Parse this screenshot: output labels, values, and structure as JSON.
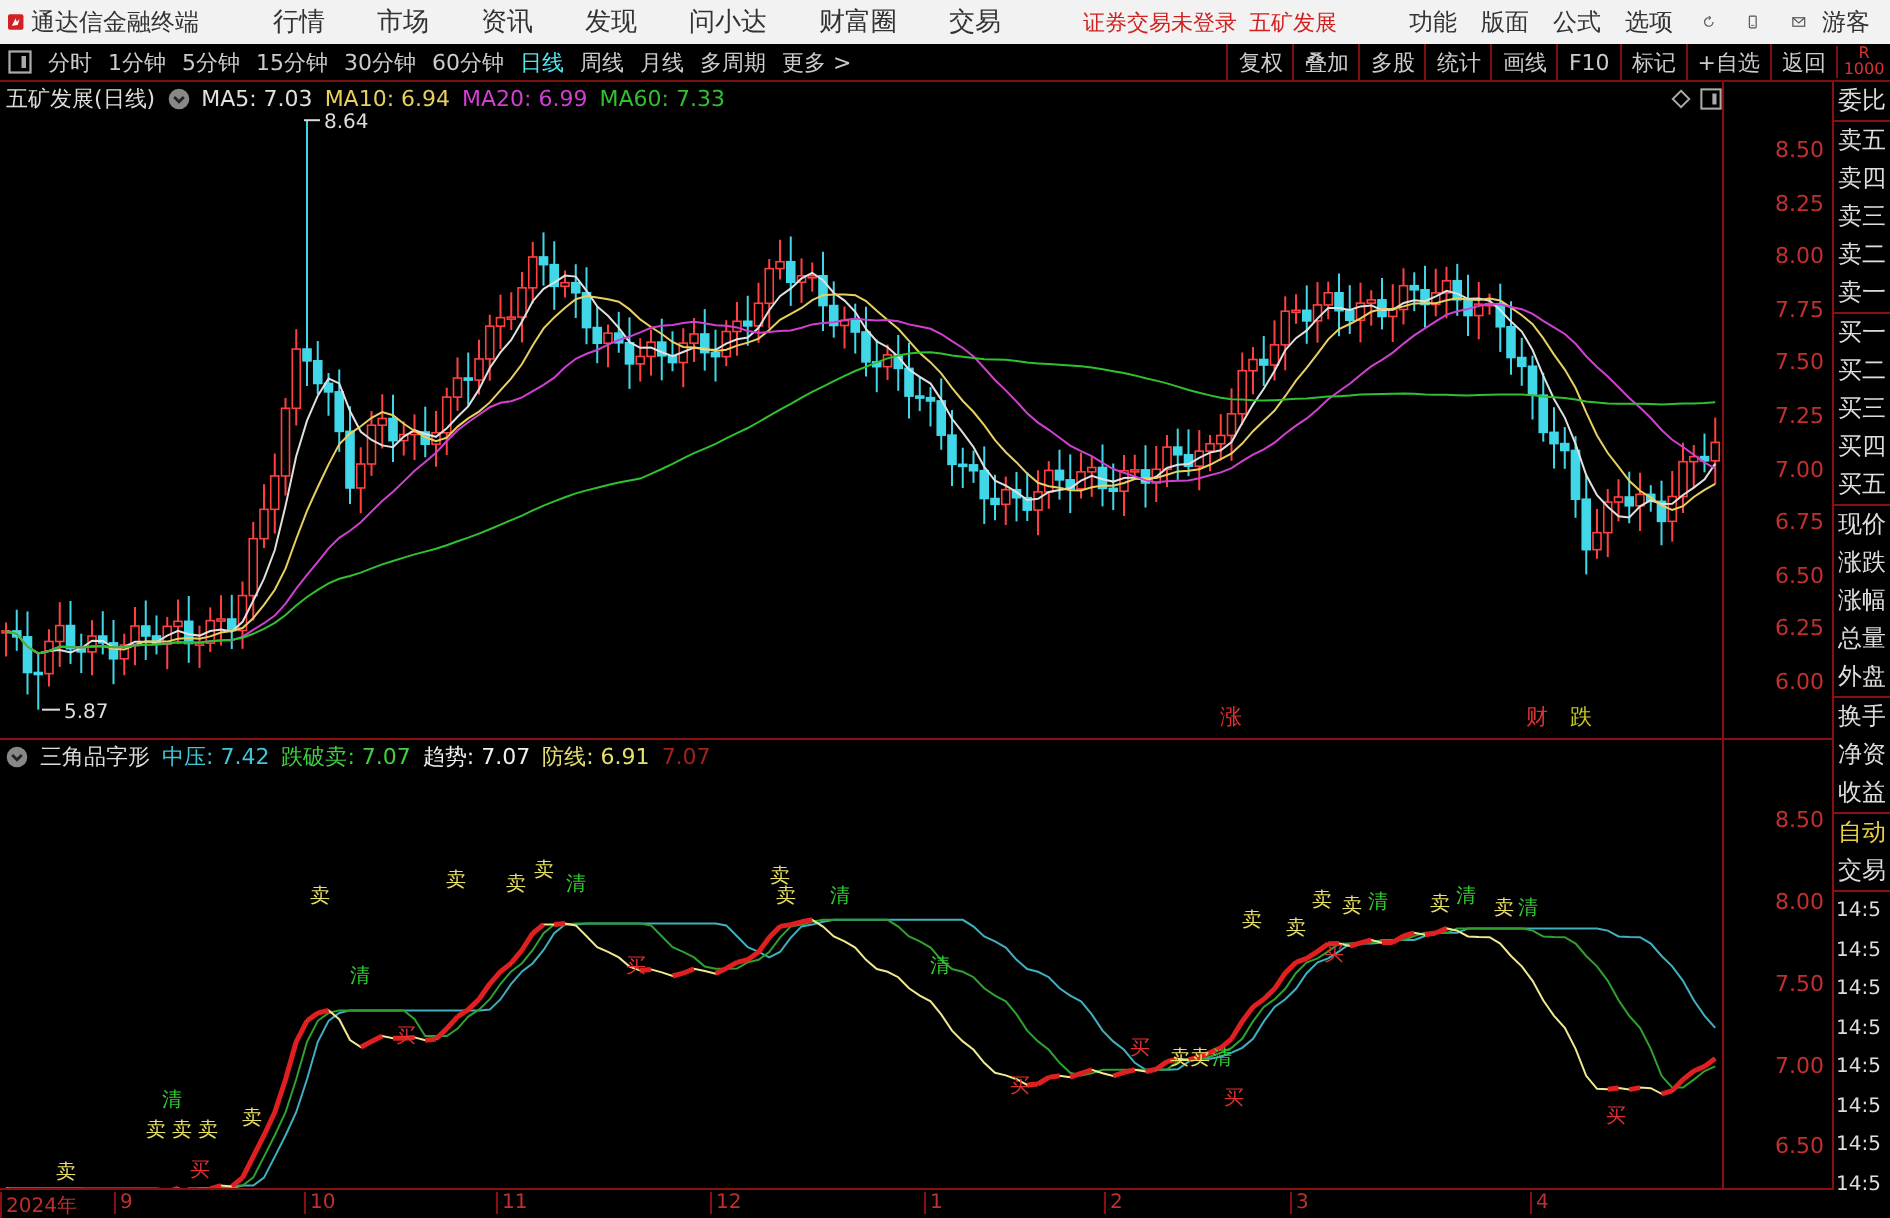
{
  "app": {
    "title": "通达信金融终端",
    "menus": [
      "行情",
      "市场",
      "资讯",
      "发现",
      "问小达",
      "财富圈",
      "交易"
    ],
    "notice": "证券交易未登录",
    "stock": "五矿发展",
    "tools": [
      "功能",
      "版面",
      "公式",
      "选项"
    ],
    "user": "游客"
  },
  "periods": [
    {
      "label": "分时",
      "selected": false
    },
    {
      "label": "1分钟",
      "selected": false
    },
    {
      "label": "5分钟",
      "selected": false
    },
    {
      "label": "15分钟",
      "selected": false
    },
    {
      "label": "30分钟",
      "selected": false
    },
    {
      "label": "60分钟",
      "selected": false
    },
    {
      "label": "日线",
      "selected": true
    },
    {
      "label": "周线",
      "selected": false
    },
    {
      "label": "月线",
      "selected": false
    },
    {
      "label": "多周期",
      "selected": false
    },
    {
      "label": "更多 >",
      "selected": false
    }
  ],
  "actions": [
    "复权",
    "叠加",
    "多股",
    "统计",
    "画线",
    "F10",
    "标记",
    "+自选",
    "返回"
  ],
  "corner": {
    "line1": "R",
    "line2": "1000"
  },
  "main_chart": {
    "title": "五矿发展(日线)",
    "mas": [
      {
        "label": "MA5: 7.03",
        "color": "#e0e0e0"
      },
      {
        "label": "MA10: 6.94",
        "color": "#e8d060"
      },
      {
        "label": "MA20: 6.99",
        "color": "#d040d0"
      },
      {
        "label": "MA60: 7.33",
        "color": "#30c030"
      }
    ],
    "high_label": "8.64",
    "low_label": "5.87",
    "yticks": [
      "8.50",
      "8.25",
      "8.00",
      "7.75",
      "7.50",
      "7.25",
      "7.00",
      "6.75",
      "6.50",
      "6.25",
      "6.00"
    ],
    "events": [
      {
        "text": "涨",
        "color": "#e03030"
      },
      {
        "text": "财",
        "color": "#e03030"
      },
      {
        "text": "跌",
        "color": "#c8c820"
      }
    ]
  },
  "indicator": {
    "title": "三角品字形",
    "values": [
      {
        "label": "中压: 7.42",
        "color": "#40c8d8"
      },
      {
        "label": "跌破卖: 7.07",
        "color": "#40d040"
      },
      {
        "label": "趋势: 7.07",
        "color": "#f0f0f0"
      },
      {
        "label": "防线: 6.91",
        "color": "#e8e070"
      },
      {
        "label": "7.07",
        "color": "#a02020"
      }
    ],
    "yticks": [
      "8.50",
      "8.00",
      "7.50",
      "7.00",
      "6.50"
    ],
    "signals": [
      {
        "text": "卖",
        "kind": "sell"
      },
      {
        "text": "清",
        "kind": "clear"
      },
      {
        "text": "买",
        "kind": "buy"
      },
      {
        "text": "卖",
        "kind": "sell"
      },
      {
        "text": "卖",
        "kind": "sell"
      },
      {
        "text": "卖",
        "kind": "sell"
      },
      {
        "text": "清",
        "kind": "clear"
      },
      {
        "text": "买",
        "kind": "buy"
      },
      {
        "text": "卖",
        "kind": "sell"
      },
      {
        "text": "卖",
        "kind": "sell"
      },
      {
        "text": "清",
        "kind": "clear"
      },
      {
        "text": "清",
        "kind": "clear"
      },
      {
        "text": "买",
        "kind": "buy"
      },
      {
        "text": "买",
        "kind": "buy"
      },
      {
        "text": "卖",
        "kind": "sell"
      },
      {
        "text": "卖",
        "kind": "sell"
      },
      {
        "text": "清",
        "kind": "clear"
      },
      {
        "text": "买",
        "kind": "buy"
      },
      {
        "text": "卖",
        "kind": "sell"
      },
      {
        "text": "卖",
        "kind": "sell"
      },
      {
        "text": "卖",
        "kind": "sell"
      },
      {
        "text": "卖",
        "kind": "sell"
      },
      {
        "text": "清",
        "kind": "clear"
      },
      {
        "text": "买",
        "kind": "buy"
      },
      {
        "text": "卖",
        "kind": "sell"
      },
      {
        "text": "清",
        "kind": "clear"
      },
      {
        "text": "卖",
        "kind": "sell"
      },
      {
        "text": "清",
        "kind": "clear"
      },
      {
        "text": "买",
        "kind": "buy"
      },
      {
        "text": "卖",
        "kind": "sell"
      },
      {
        "text": "清",
        "kind": "clear"
      },
      {
        "text": "卖",
        "kind": "sell"
      },
      {
        "text": "卖",
        "kind": "sell"
      },
      {
        "text": "卖",
        "kind": "sell"
      },
      {
        "text": "卖",
        "kind": "sell"
      },
      {
        "text": "买",
        "kind": "buy"
      }
    ]
  },
  "side_panel": {
    "rows": [
      "委比",
      "卖五",
      "卖四",
      "卖三",
      "卖二",
      "卖一",
      "买一",
      "买二",
      "买三",
      "买四",
      "买五",
      "现价",
      "涨跌",
      "涨幅",
      "总量",
      "外盘",
      "换手",
      "净资",
      "收益"
    ],
    "mode": "自动",
    "trade": "交易",
    "times": [
      "14:5",
      "14:5",
      "14:5",
      "14:5",
      "14:5",
      "14:5",
      "14:5",
      "14:5"
    ]
  },
  "dates": [
    "2024年",
    "9",
    "10",
    "11",
    "12",
    "1",
    "2",
    "3",
    "4"
  ]
}
